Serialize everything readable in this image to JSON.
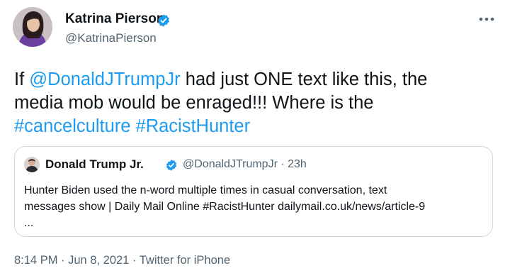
{
  "author": {
    "name": "Katrina Pierson",
    "handle": "@KatrinaPierson"
  },
  "icons": {
    "verified": "verified-badge-icon",
    "more": "more-options-icon",
    "avatar": "profile-photo"
  },
  "colors": {
    "link": "#1d9bf0",
    "verified": "#1d9bf0",
    "secondary_text": "#536471",
    "border": "#cfd9de"
  },
  "tweet": {
    "line1": {
      "pre": "If ",
      "mention": "@DonaldJTrumpJr",
      "post": " had just ONE text like this, the"
    },
    "line2": "media mob would be enraged!!! Where is the",
    "line3": {
      "hashtag1": "#cancelculture",
      "space": " ",
      "hashtag2": "#RacistHunter"
    }
  },
  "quote": {
    "name": "Donald Trump Jr.",
    "handle": "@DonaldJTrumpJr",
    "separator": " · ",
    "time": "23h",
    "line1": "Hunter Biden used the n-word multiple times in casual conversation, text",
    "line2": "messages show | Daily Mail Online #RacistHunter  dailymail.co.uk/news/article-9",
    "line3": "..."
  },
  "footer": {
    "time": "8:14 PM",
    "sep1": " · ",
    "date": "Jun 8, 2021",
    "sep2": " · ",
    "source": "Twitter for iPhone"
  }
}
